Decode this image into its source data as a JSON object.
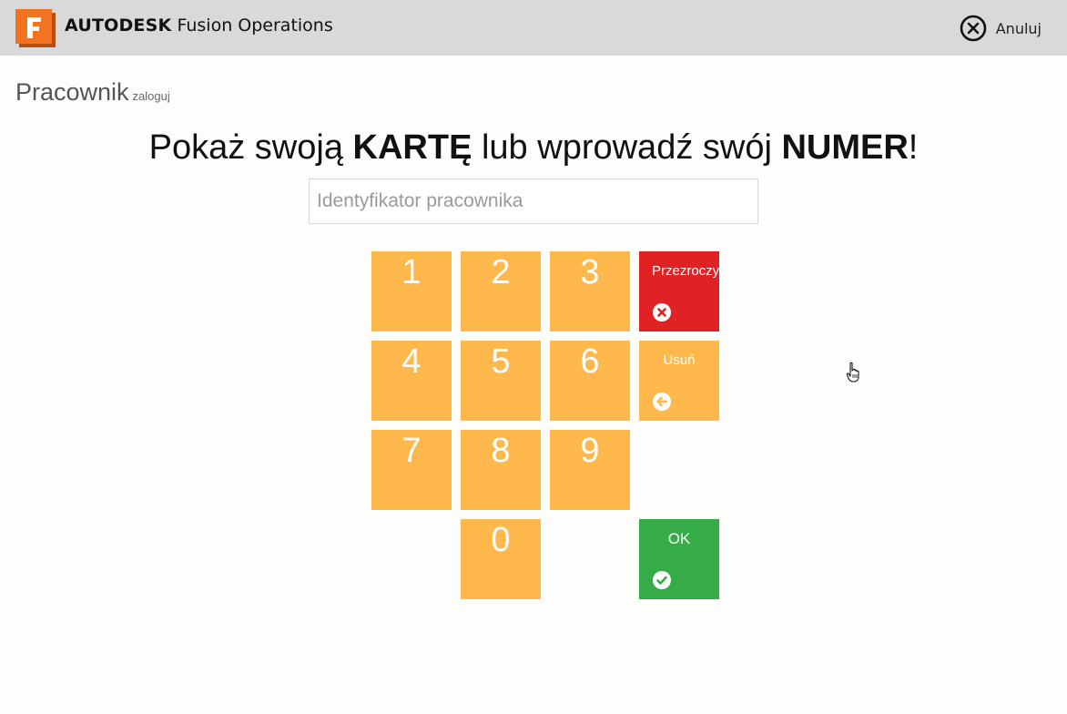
{
  "header": {
    "brand_bold": "AUTODESK",
    "brand_rest": "Fusion Operations",
    "cancel_label": "Anuluj"
  },
  "page": {
    "title": "Pracownik",
    "subtitle": "zaloguj"
  },
  "prompt": {
    "part1": "Pokaż swoją ",
    "card": "KARTĘ",
    "part2": " lub wprowadź swój ",
    "number": "NUMER",
    "end": "!"
  },
  "input": {
    "placeholder": "Identyfikator pracownika",
    "value": ""
  },
  "keypad": {
    "digits": [
      "1",
      "2",
      "3",
      "4",
      "5",
      "6",
      "7",
      "8",
      "9",
      "0"
    ],
    "clear_label": "Przezroczy",
    "delete_label": "Usuń",
    "ok_label": "OK"
  },
  "colors": {
    "key": "#feb84c",
    "clear": "#e02224",
    "ok": "#36ac48",
    "topbar": "#d9d9d9",
    "logo": "#f37321"
  }
}
